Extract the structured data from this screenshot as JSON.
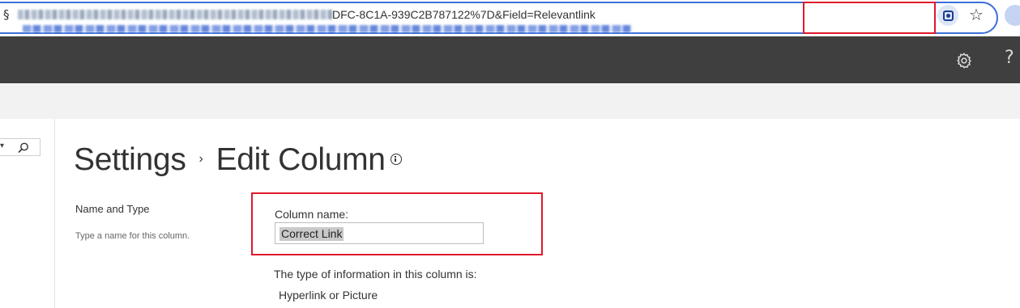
{
  "browser": {
    "url_visible_tail": "DFC-8C1A-939C2B787122%7D&Field=Relevantlink",
    "url_highlighted": "&Field=Relevantlink",
    "url_prefix_obscured": "FC-8C1A-939C2B787122%7D",
    "icons": [
      "google-lens-icon",
      "bookmark-star-icon",
      "profile-icon"
    ]
  },
  "suite_bar": {
    "icons": [
      "gear-icon",
      "help-icon"
    ],
    "help_glyph": "?"
  },
  "left_nav": {
    "search_dropdown_glyph": "▾",
    "icons": [
      "search-icon"
    ]
  },
  "page": {
    "title_part1": "Settings",
    "title_separator": "›",
    "title_part2": "Edit Column",
    "info_icon": "info-icon"
  },
  "section": {
    "label": "Name and Type",
    "description": "Type a name for this column."
  },
  "column_name": {
    "label": "Column name:",
    "value": "Correct Link"
  },
  "type_info": {
    "label": "The type of information in this column is:",
    "value": "Hyperlink or Picture"
  },
  "colors": {
    "suite_bar": "#3f3f3f",
    "highlight_red": "#e0192b",
    "address_bar_border": "#3b6fd8",
    "grey_band": "#f2f2f2"
  }
}
